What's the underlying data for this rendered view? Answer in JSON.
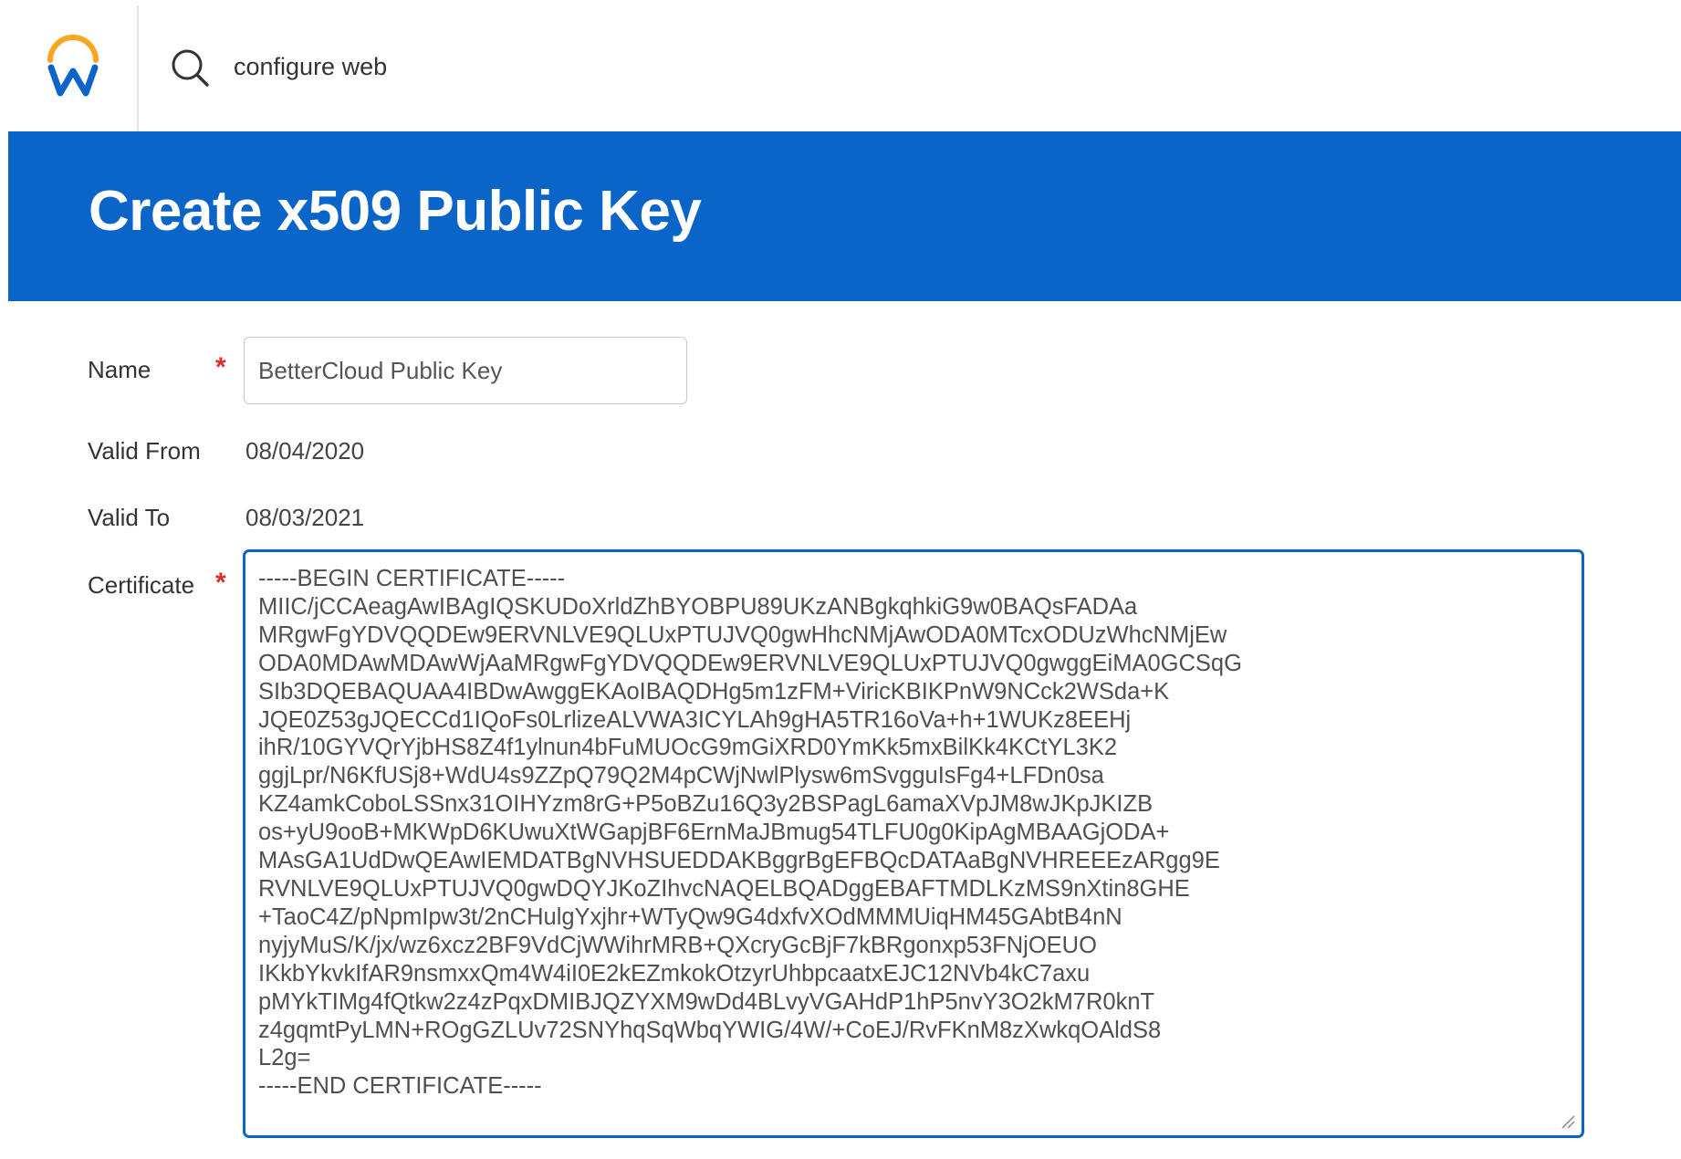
{
  "search": {
    "query": "configure web"
  },
  "page": {
    "title": "Create x509 Public Key"
  },
  "form": {
    "name": {
      "label": "Name",
      "required_mark": "*",
      "value": "BetterCloud Public Key"
    },
    "valid_from": {
      "label": "Valid From",
      "value": "08/04/2020"
    },
    "valid_to": {
      "label": "Valid To",
      "value": "08/03/2021"
    },
    "certificate": {
      "label": "Certificate",
      "required_mark": "*",
      "value": "-----BEGIN CERTIFICATE-----\nMIIC/jCCAeagAwIBAgIQSKUDoXrldZhBYOBPU89UKzANBgkqhkiG9w0BAQsFADAa\nMRgwFgYDVQQDEw9ERVNLVE9QLUxPTUJVQ0gwHhcNMjAwODA0MTcxODUzWhcNMjEw\nODA0MDAwMDAwWjAaMRgwFgYDVQQDEw9ERVNLVE9QLUxPTUJVQ0gwggEiMA0GCSqG\nSIb3DQEBAQUAA4IBDwAwggEKAoIBAQDHg5m1zFM+ViricKBIKPnW9NCck2WSda+K\nJQE0Z53gJQECCd1IQoFs0LrlizeALVWA3ICYLAh9gHA5TR16oVa+h+1WUKz8EEHj\nihR/10GYVQrYjbHS8Z4f1ylnun4bFuMUOcG9mGiXRD0YmKk5mxBilKk4KCtYL3K2\nggjLpr/N6KfUSj8+WdU4s9ZZpQ79Q2M4pCWjNwlPlysw6mSvgguIsFg4+LFDn0sa\nKZ4amkCoboLSSnx31OIHYzm8rG+P5oBZu16Q3y2BSPagL6amaXVpJM8wJKpJKIZB\nos+yU9ooB+MKWpD6KUwuXtWGapjBF6ErnMaJBmug54TLFU0g0KipAgMBAAGjODA+\nMAsGA1UdDwQEAwIEMDATBgNVHSUEDDAKBggrBgEFBQcDATAaBgNVHREEEzARgg9E\nRVNLVE9QLUxPTUJVQ0gwDQYJKoZIhvcNAQELBQADggEBAFTMDLKzMS9nXtin8GHE\n+TaoC4Z/pNpmIpw3t/2nCHulgYxjhr+WTyQw9G4dxfvXOdMMMUiqHM45GAbtB4nN\nnyjyMuS/K/jx/wz6xcz2BF9VdCjWWihrMRB+QXcryGcBjF7kBRgonxp53FNjOEUO\nIKkbYkvkIfAR9nsmxxQm4W4iI0E2kEZmkokOtzyrUhbpcaatxEJC12NVb4kC7axu\npMYkTIMg4fQtkw2z4zPqxDMIBJQZYXM9wDd4BLvyVGAHdP1hP5nvY3O2kM7R0knT\nz4gqmtPyLMN+ROgGZLUv72SNYhqSqWbqYWIG/4W/+CoEJ/RvFKnM8zXwkqOAldS8\nL2g=\n-----END CERTIFICATE-----"
    }
  },
  "colors": {
    "brand_blue": "#0b64c8",
    "logo_orange": "#f5a623",
    "logo_blue": "#0b64c8",
    "required_red": "#de2b2b"
  },
  "icons": {
    "logo": "workday-logo-icon",
    "search": "search-icon",
    "resize": "resize-handle-icon"
  }
}
